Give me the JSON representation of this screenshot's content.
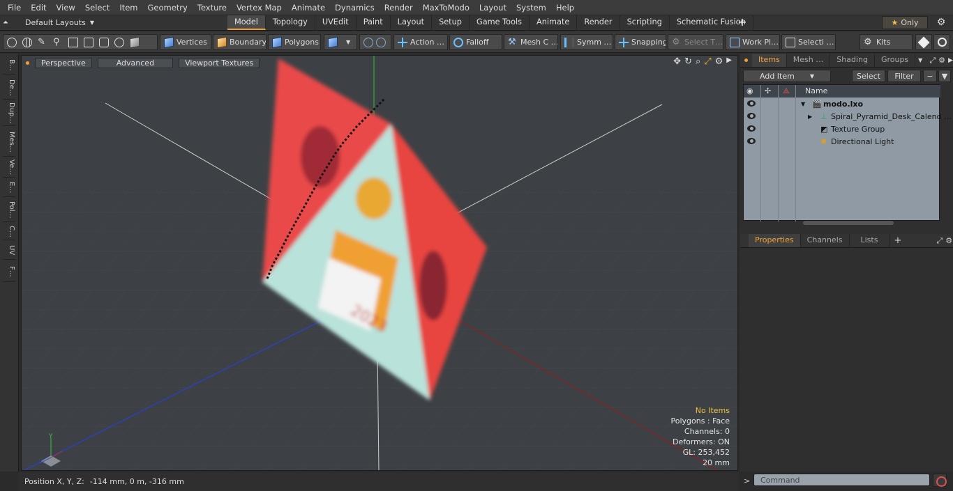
{
  "menu": [
    "File",
    "Edit",
    "View",
    "Select",
    "Item",
    "Geometry",
    "Texture",
    "Vertex Map",
    "Animate",
    "Dynamics",
    "Render",
    "MaxToModo",
    "Layout",
    "System",
    "Help"
  ],
  "layouts": {
    "current": "Default Layouts",
    "tabs": [
      "Model",
      "Topology",
      "UVEdit",
      "Paint",
      "Layout",
      "Setup",
      "Game Tools",
      "Animate",
      "Render",
      "Scripting",
      "Schematic Fusion"
    ],
    "active": "Model",
    "only_label": "Only"
  },
  "toolbar": {
    "vertices": "Vertices",
    "boundary": "Boundary",
    "polygons": "Polygons",
    "action": "Action …",
    "falloff": "Falloff",
    "mesh": "Mesh C …",
    "symmetry": "Symm …",
    "snapping": "Snapping",
    "select_t": "Select T…",
    "work_plane": "Work Pl…",
    "selection": "Selecti …",
    "kits": "Kits"
  },
  "left_tabs": [
    "B…",
    "De…",
    "Dup…",
    "Mes…",
    "Ve…",
    "E…",
    "Pol…",
    "C…",
    "UV",
    "F…"
  ],
  "viewport": {
    "perspective": "Perspective",
    "advanced": "Advanced",
    "viewport_textures": "Viewport Textures"
  },
  "stats": {
    "items": "No Items",
    "polygons": "Polygons : Face",
    "channels": "Channels: 0",
    "deformers": "Deformers: ON",
    "gl": "GL: 253,452",
    "scale": "20 mm"
  },
  "status": {
    "position_label": "Position X, Y, Z:",
    "position_value": "-114 mm, 0 m, -316 mm"
  },
  "items_panel": {
    "tabs": [
      "Items",
      "Mesh …",
      "Shading",
      "Groups"
    ],
    "add_item": "Add Item",
    "select": "Select",
    "filter": "Filter",
    "name_header": "Name",
    "tree": [
      {
        "label": "modo.lxo",
        "bold": true
      },
      {
        "label": "Spiral_Pyramid_Desk_Calend …",
        "bold": false
      },
      {
        "label": "Texture Group",
        "bold": false
      },
      {
        "label": "Directional Light",
        "bold": false
      }
    ]
  },
  "props_panel": {
    "tabs": [
      "Properties",
      "Channels",
      "Lists"
    ]
  },
  "command": {
    "placeholder": "Command"
  }
}
